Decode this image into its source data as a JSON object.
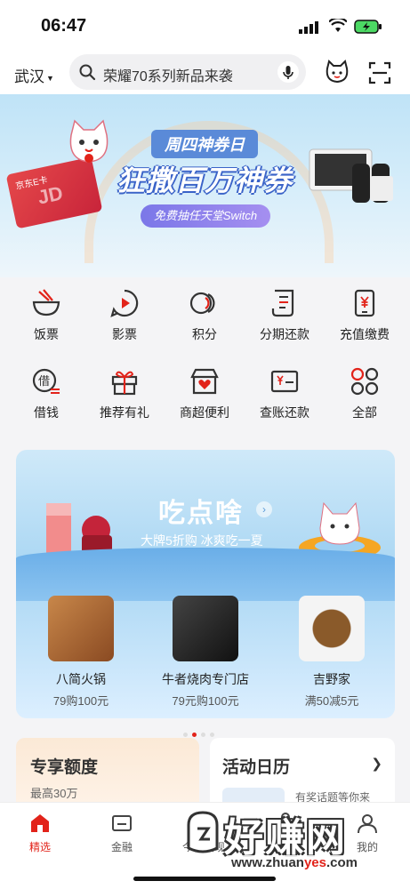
{
  "status_bar": {
    "time": "06:47"
  },
  "header": {
    "location": "武汉",
    "search_placeholder": "荣耀70系列新品来袭"
  },
  "banner": {
    "subtitle": "周四神券日",
    "title": "狂撒百万神券",
    "pill": "免费抽任天堂Switch",
    "card_text": "京东E卡",
    "card_value": "JD"
  },
  "services": [
    {
      "label": "饭票",
      "icon": "bowl-icon"
    },
    {
      "label": "影票",
      "icon": "movie-play-icon"
    },
    {
      "label": "积分",
      "icon": "points-coins-icon"
    },
    {
      "label": "分期还款",
      "icon": "installment-bill-icon"
    },
    {
      "label": "充值缴费",
      "icon": "yen-phone-icon"
    },
    {
      "label": "借钱",
      "icon": "loan-icon"
    },
    {
      "label": "推荐有礼",
      "icon": "gift-icon"
    },
    {
      "label": "商超便利",
      "icon": "store-heart-icon"
    },
    {
      "label": "查账还款",
      "icon": "bill-card-icon"
    },
    {
      "label": "全部",
      "icon": "all-grid-icon"
    }
  ],
  "food": {
    "title": "吃点啥",
    "subtitle": "大牌5折购 冰爽吃一夏",
    "shops": [
      {
        "name": "八简火锅",
        "deal": "79购100元"
      },
      {
        "name": "牛者烧肉专门店",
        "deal": "79元购100元"
      },
      {
        "name": "吉野家",
        "deal": "满50减5元"
      }
    ]
  },
  "cards": {
    "quota_title": "专享额度",
    "quota_sub": "最高30万",
    "calendar_title": "活动日历",
    "calendar_sub": "有奖话题等你来"
  },
  "tabs": [
    {
      "label": "精选",
      "active": true
    },
    {
      "label": "金融",
      "active": false
    },
    {
      "label": "今日发现",
      "active": false
    },
    {
      "label": "商城",
      "active": false
    },
    {
      "label": "我的",
      "active": false
    }
  ],
  "watermark": {
    "text": "好赚网",
    "url_prefix": "www.zhuan",
    "url_highlight": "yes",
    "url_suffix": ".com"
  },
  "colors": {
    "accent": "#e2231a",
    "icon": "#333333"
  }
}
